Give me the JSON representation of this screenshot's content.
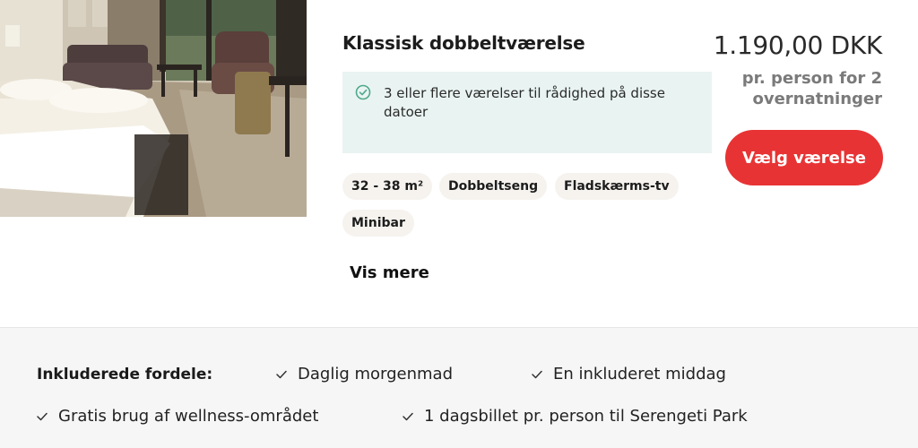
{
  "room": {
    "title": "Klassisk dobbeltværelse",
    "availability": "3 eller flere værelser til rådighed på disse datoer",
    "tags": [
      "32 - 38 m²",
      "Dobbeltseng",
      "Fladskærms-tv",
      "Minibar"
    ],
    "show_more": "Vis mere"
  },
  "pricing": {
    "price": "1.190,00 DKK",
    "price_note": "pr. person for 2 overnatninger",
    "select_label": "Vælg værelse"
  },
  "benefits": {
    "label": "Inkluderede fordele:",
    "items": [
      "Daglig morgenmad",
      "En inkluderet middag",
      "Gratis brug af wellness-området",
      "1 dagsbillet pr. person til Serengeti Park"
    ]
  },
  "colors": {
    "accent": "#e83334",
    "availability_bg": "#e9f4f2",
    "check_green": "#4fa889"
  },
  "icons": {
    "availability": "check-circle-icon",
    "benefit": "checkmark-icon"
  }
}
